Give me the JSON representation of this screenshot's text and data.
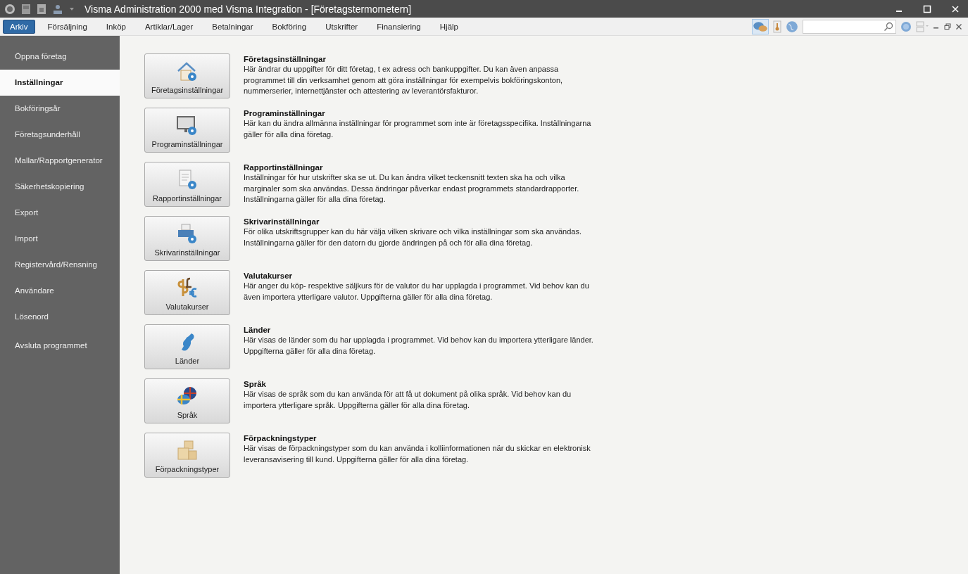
{
  "window": {
    "title": "Visma Administration 2000 med Visma Integration - [Företagstermometern]"
  },
  "menu": [
    {
      "label": "Arkiv",
      "selected": true
    },
    {
      "label": "Försäljning",
      "selected": false
    },
    {
      "label": "Inköp",
      "selected": false
    },
    {
      "label": "Artiklar/Lager",
      "selected": false
    },
    {
      "label": "Betalningar",
      "selected": false
    },
    {
      "label": "Bokföring",
      "selected": false
    },
    {
      "label": "Utskrifter",
      "selected": false
    },
    {
      "label": "Finansiering",
      "selected": false
    },
    {
      "label": "Hjälp",
      "selected": false
    }
  ],
  "sidebar": {
    "items": [
      {
        "label": "Öppna företag",
        "selected": false
      },
      {
        "label": "Inställningar",
        "selected": true
      },
      {
        "label": "Bokföringsår",
        "selected": false
      },
      {
        "label": "Företagsunderhåll",
        "selected": false
      },
      {
        "label": "Mallar/Rapportgenerator",
        "selected": false
      },
      {
        "label": "Säkerhetskopiering",
        "selected": false
      },
      {
        "label": "Export",
        "selected": false
      },
      {
        "label": "Import",
        "selected": false
      },
      {
        "label": "Registervård/Rensning",
        "selected": false
      },
      {
        "label": "Användare",
        "selected": false
      },
      {
        "label": "Lösenord",
        "selected": false
      },
      {
        "label": "Avsluta programmet",
        "selected": false
      }
    ]
  },
  "settings": [
    {
      "kind": "company",
      "button": "Företagsinställningar",
      "title": "Företagsinställningar",
      "description": "Här ändrar du uppgifter för ditt företag, t ex adress och bankuppgifter. Du kan även anpassa programmet till din verksamhet genom att göra inställningar för exempelvis bokföringskonton, nummerserier, internettjänster och attestering av leverantörsfakturor."
    },
    {
      "kind": "program",
      "button": "Programinställningar",
      "title": "Programinställningar",
      "description": "Här kan du ändra allmänna inställningar för programmet som inte är företagsspecifika. Inställningarna gäller för alla dina företag."
    },
    {
      "kind": "report",
      "button": "Rapportinställningar",
      "title": "Rapportinställningar",
      "description": "Inställningar för hur utskrifter ska se ut. Du kan ändra vilket teckensnitt texten ska ha och vilka marginaler som ska användas. Dessa ändringar påverkar endast programmets standardrapporter. Inställningarna gäller för alla dina företag."
    },
    {
      "kind": "printer",
      "button": "Skrivarinställningar",
      "title": "Skrivarinställningar",
      "description": "För olika utskriftsgrupper kan du här välja vilken skrivare och vilka inställningar som ska användas. Inställningarna gäller för den datorn du gjorde ändringen på och för alla dina företag."
    },
    {
      "kind": "currency",
      "button": "Valutakurser",
      "title": "Valutakurser",
      "description": "Här anger du köp- respektive säljkurs för de valutor du har upplagda i programmet. Vid behov kan du även importera ytterligare valutor. Uppgifterna gäller för alla dina företag."
    },
    {
      "kind": "country",
      "button": "Länder",
      "title": "Länder",
      "description": "Här visas de länder som du har upplagda i programmet. Vid behov kan du importera ytterligare länder. Uppgifterna gäller för alla dina företag."
    },
    {
      "kind": "language",
      "button": "Språk",
      "title": "Språk",
      "description": "Här visas de språk som du kan använda för att få ut dokument på olika språk. Vid behov kan du importera ytterligare språk. Uppgifterna gäller för alla dina företag."
    },
    {
      "kind": "package",
      "button": "Förpackningstyper",
      "title": "Förpackningstyper",
      "description": "Här visas de förpackningstyper som du kan använda i kolliinformationen när du skickar en elektronisk leveransavisering till kund. Uppgifterna gäller för alla dina företag."
    }
  ]
}
